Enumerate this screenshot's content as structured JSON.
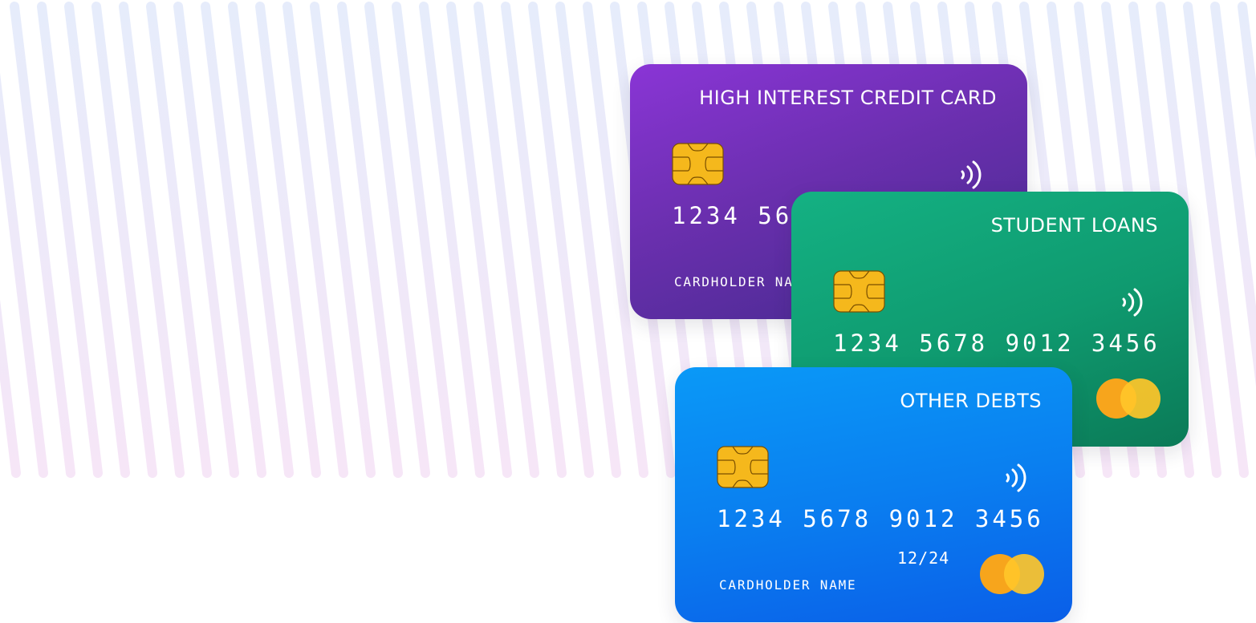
{
  "cards": {
    "high_interest": {
      "title": "HIGH INTEREST CREDIT CARD",
      "number": "1234 5678 9012 3456",
      "holder": "CARDHOLDER NAME"
    },
    "student_loans": {
      "title": "STUDENT LOANS",
      "number": "1234 5678 9012 3456"
    },
    "other_debts": {
      "title": "OTHER DEBTS",
      "number": "1234 5678 9012 3456",
      "expiry": "12/24",
      "holder": "CARDHOLDER NAME"
    }
  },
  "colors": {
    "purple_card": "#7a32c4",
    "green_card": "#10a577",
    "blue_card": "#0a85f2",
    "chip": "#f5b81c",
    "mastercard_left": "#f7a51c",
    "mastercard_right": "#ffc629",
    "stripe_top": "#e6ecfb",
    "stripe_bottom": "#f6e6f7"
  },
  "icons": [
    "chip-icon",
    "contactless-icon",
    "mastercard-logo"
  ]
}
